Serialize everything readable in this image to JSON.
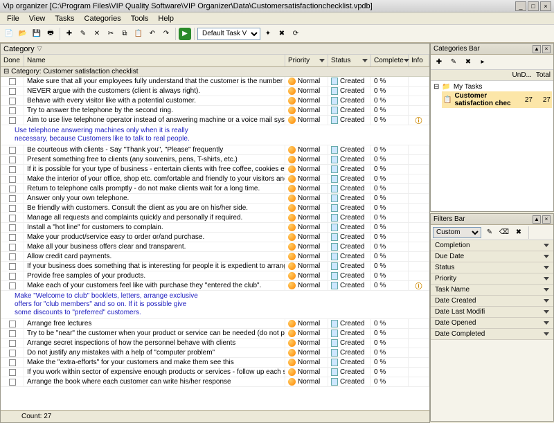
{
  "title": "Vip organizer [C:\\Program Files\\VIP Quality Software\\VIP Organizer\\Data\\Customersatisfactionchecklist.vpdb]",
  "menu": [
    "File",
    "View",
    "Tasks",
    "Categories",
    "Tools",
    "Help"
  ],
  "toolbar_select": "Default Task V",
  "category_label": "Category",
  "columns": {
    "done": "Done",
    "name": "Name",
    "priority": "Priority",
    "status": "Status",
    "complete": "Complete",
    "info": "Info"
  },
  "group_label": "Category: Customer satisfaction checklist",
  "note1": "Use telephone answering machines only when it is really\nnecessary, because Customers like to talk to real people.",
  "note2": "Make \"Welcome to club\" booklets, letters, arrange exclusive\noffers for \"club members\" and so on. If it is possible give\nsome discounts to \"preferred\" customers.",
  "tasks_a": [
    "Make sure that all your employees fully understand that the customer is the number one in the business.",
    "NEVER argue with the customers (client is always right).",
    "Behave with every visitor like with a potential customer.",
    "Try to answer the telephone by the second ring.",
    "Aim to use live telephone operator instead of answering machine or a voice mail system."
  ],
  "tasks_b": [
    "Be courteous with clients - Say \"Thank you\", \"Please\" frequently",
    "Present something free to clients (any souvenirs, pens, T-shirts, etc.)",
    "If it is possible for your type of business - entertain clients with free coffee, cookies etc. while they wait.",
    "Make the interior of your office, shop etc. comfortable and friendly to your visitors and customers as much as possible.",
    "Return to telephone calls promptly - do not make clients wait for a long time.",
    "Answer only your own telephone.",
    "Be friendly with customers. Consult the client as you are on his/her side.",
    "Manage all requests and complaints quickly and personally if required.",
    "Install a \"hot line\" for customers to complain.",
    "Make your product/service easy to order or/and purchase.",
    "Make all your business offers clear and transparent.",
    "Allow credit card payments.",
    "If your business does something that is interesting for people it is expedient to arrange \"Doors open day\" periodically.",
    "Provide free samples of your products.",
    "Make each of your customers feel like with purchase they \"entered the club\"."
  ],
  "tasks_c": [
    "Arrange free lectures",
    "Try to be \"near\" the customer when your product or service can be needed (do not pester your clients)",
    "Arrange secret inspections of how the personnel behave with clients",
    "Do not justify any mistakes with a help of \"computer problem\"",
    "Make the \"extra-efforts\" for your customers and make them see this",
    "If you work within sector of expensive enough products or services - follow up each sale with a telephone call or written communication.",
    "Arrange the book where each customer can write his/her response"
  ],
  "priority_label": "Normal",
  "status_label": "Created",
  "complete_label": "0 %",
  "statusbar": "Count: 27",
  "categories_bar": {
    "title": "Categories Bar",
    "cols": {
      "c1": "UnD...",
      "c2": "Total"
    },
    "root": "My Tasks",
    "item": "Customer satisfaction chec",
    "v1": "27",
    "v2": "27"
  },
  "filters_bar": {
    "title": "Filters Bar",
    "preset": "Custom",
    "fields": [
      "Completion",
      "Due Date",
      "Status",
      "Priority",
      "Task Name",
      "Date Created",
      "Date Last Modifi",
      "Date Opened",
      "Date Completed"
    ]
  }
}
